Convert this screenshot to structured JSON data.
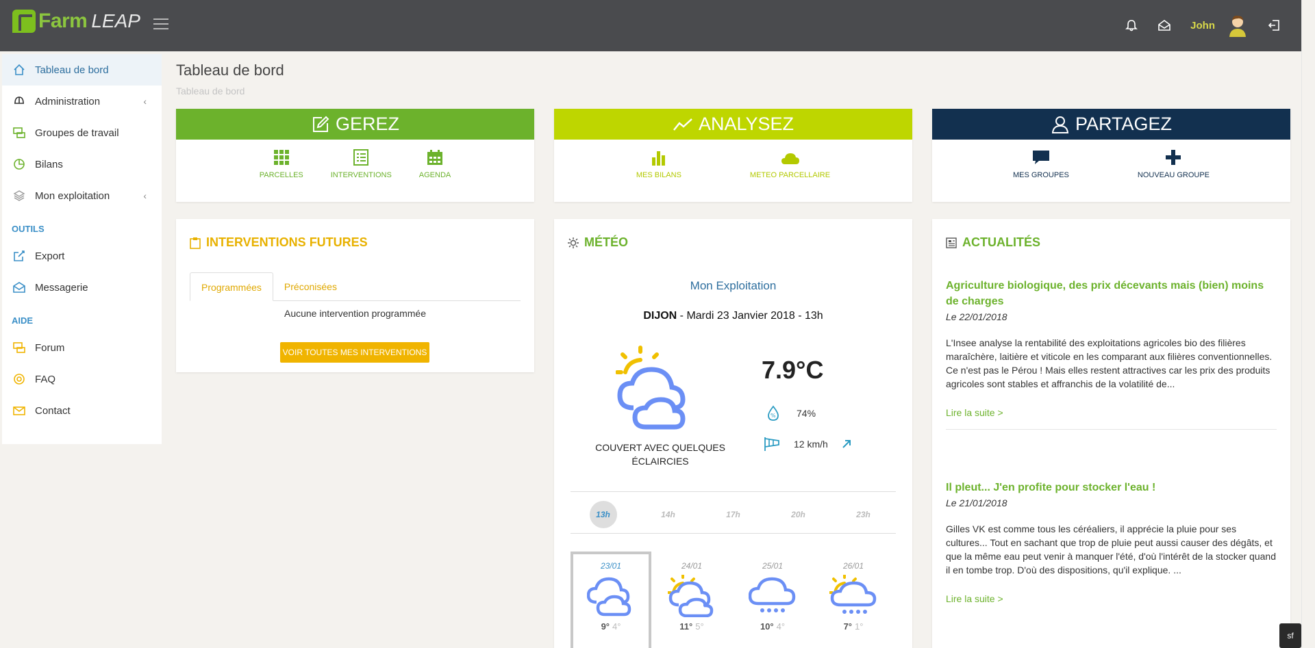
{
  "app": {
    "logo_farm": "Farm",
    "logo_leap": "LEAP"
  },
  "topbar": {
    "user_name": "John"
  },
  "sidebar": {
    "items": [
      {
        "label": "Tableau de bord"
      },
      {
        "label": "Administration"
      },
      {
        "label": "Groupes de travail"
      },
      {
        "label": "Bilans"
      },
      {
        "label": "Mon exploitation"
      }
    ],
    "section_outils": "OUTILS",
    "outils": [
      {
        "label": "Export"
      },
      {
        "label": "Messagerie"
      }
    ],
    "section_aide": "AIDE",
    "aide": [
      {
        "label": "Forum"
      },
      {
        "label": "FAQ"
      },
      {
        "label": "Contact"
      }
    ]
  },
  "page": {
    "title": "Tableau de bord",
    "breadcrumb": "Tableau de bord"
  },
  "cards": {
    "gerez": {
      "title": "GEREZ",
      "links": [
        "PARCELLES",
        "INTERVENTIONS",
        "AGENDA"
      ],
      "color": "#6cb22c"
    },
    "analysez": {
      "title": "ANALYSEZ",
      "links": [
        "MES BILANS",
        "METEO PARCELLAIRE"
      ],
      "color": "#bed600"
    },
    "partagez": {
      "title": "PARTAGEZ",
      "links": [
        "MES GROUPES",
        "NOUVEAU GROUPE"
      ],
      "color": "#12304f"
    }
  },
  "interventions": {
    "title": "INTERVENTIONS FUTURES",
    "tabs": [
      "Programmées",
      "Préconisées"
    ],
    "empty": "Aucune intervention programmée",
    "button": "VOIR TOUTES MES INTERVENTIONS"
  },
  "meteo": {
    "title": "MÉTÉO",
    "location": "Mon Exploitation",
    "city": "DIJON",
    "date": " - Mardi 23 Janvier 2018 - 13h",
    "description": "COUVERT AVEC QUELQUES ÉCLAIRCIES",
    "temperature": "7.9°C",
    "humidity": "74%",
    "wind": "12 km/h",
    "hours": [
      "13h",
      "14h",
      "17h",
      "20h",
      "23h"
    ],
    "days": [
      {
        "date": "23/01",
        "max": "9°",
        "min": "4°",
        "icon": "partly-cloudy-icon"
      },
      {
        "date": "24/01",
        "max": "11°",
        "min": "5°",
        "icon": "sun-cloud-icon"
      },
      {
        "date": "25/01",
        "max": "10°",
        "min": "4°",
        "icon": "rain-icon"
      },
      {
        "date": "26/01",
        "max": "7°",
        "min": "1°",
        "icon": "sun-rain-icon"
      }
    ]
  },
  "news": {
    "title": "ACTUALITÉS",
    "items": [
      {
        "title": "Agriculture biologique, des prix décevants mais (bien) moins de charges",
        "date": "Le 22/01/2018",
        "body": "L'Insee analyse la rentabilité des exploitations agricoles bio des filières maraîchère, laitière et viticole en les comparant aux filières conventionnelles. Ce n'est pas le Pérou ! Mais elles restent attractives car les prix des produits agricoles sont stables et affranchis de la volatilité de...",
        "more": "Lire la suite >"
      },
      {
        "title": "Il pleut... J'en profite pour stocker l'eau !",
        "date": "Le 21/01/2018",
        "body": "Gilles VK est comme tous les céréaliers, il apprécie la pluie pour ses cultures... Tout en sachant que trop de pluie peut aussi causer des dégâts, et que la même eau peut venir à manquer l'été, d'où l'intérêt de la stocker quand il en tombe trop. D'où des dispositions, qu'il explique. ...",
        "more": "Lire la suite >"
      }
    ]
  }
}
